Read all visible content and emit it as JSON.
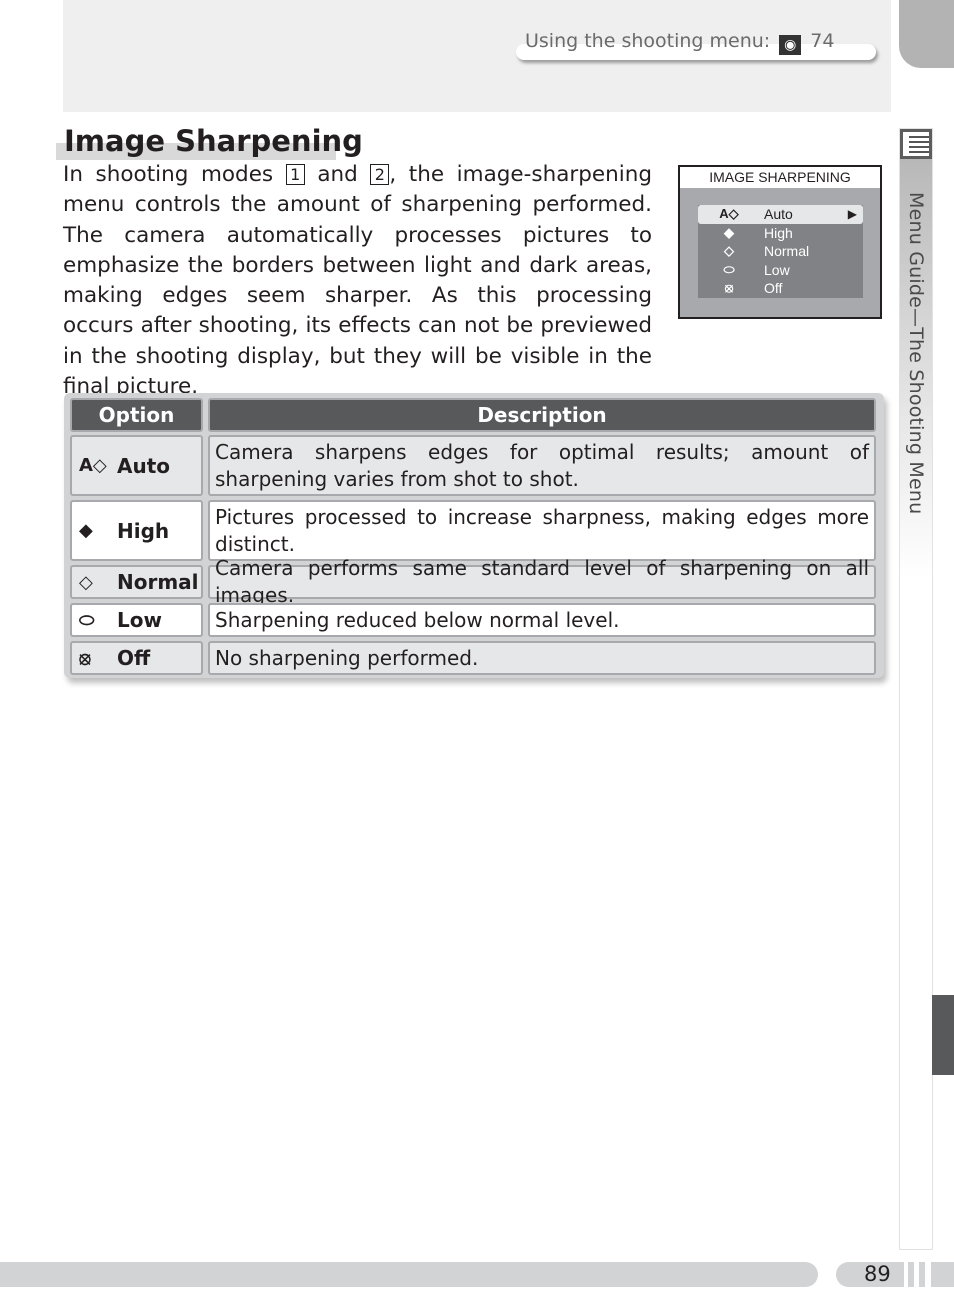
{
  "header": {
    "xref_text": "Using the shooting menu:",
    "xref_icon": "eye-icon",
    "xref_page": "74"
  },
  "side_tab": {
    "icon": "menu-list-icon",
    "label": "Menu Guide—The Shooting Menu"
  },
  "section": {
    "title": "Image Sharpening",
    "intro_part1": "In shooting modes ",
    "mode1": "1",
    "intro_and": " and ",
    "mode2": "2",
    "intro_part2": ", the image-sharpening menu controls the amount of sharpening performed. The camera automatically processes pictures to emphasize the borders between light and dark areas, making edges seem sharper.  As this processing occurs after shooting, its effects can not be previewed in the shooting display, but they will be visible in the final picture."
  },
  "camera_screen": {
    "title": "IMAGE SHARPENING",
    "items": [
      {
        "icon": "A◇",
        "icon_name": "auto-sharpening-icon",
        "label": "Auto",
        "selected": true,
        "arrow": "▶"
      },
      {
        "icon": "◆",
        "icon_name": "high-sharpening-icon",
        "label": "High",
        "selected": false
      },
      {
        "icon": "◇",
        "icon_name": "normal-sharpening-icon",
        "label": "Normal",
        "selected": false
      },
      {
        "icon": "⬭",
        "icon_name": "low-sharpening-icon",
        "label": "Low",
        "selected": false
      },
      {
        "icon": "⦻",
        "icon_name": "off-sharpening-icon",
        "label": "Off",
        "selected": false
      }
    ]
  },
  "table": {
    "headers": [
      "Option",
      "Description"
    ],
    "rows": [
      {
        "icon": "A◇",
        "icon_name": "auto-sharpening-icon",
        "option": "Auto",
        "description": "Camera sharpens edges for optimal results; amount of sharpening varies from shot to shot."
      },
      {
        "icon": "◆",
        "icon_name": "high-sharpening-icon",
        "option": "High",
        "description": "Pictures processed to increase sharpness, making edges more distinct."
      },
      {
        "icon": "◇",
        "icon_name": "normal-sharpening-icon",
        "option": "Normal",
        "description": "Camera performs same standard level of sharpening on all images."
      },
      {
        "icon": "⬭",
        "icon_name": "low-sharpening-icon",
        "option": "Low",
        "description": "Sharpening reduced below normal level."
      },
      {
        "icon": "⦻",
        "icon_name": "off-sharpening-icon",
        "option": "Off",
        "description": "No sharpening performed."
      }
    ]
  },
  "footer": {
    "page_number": "89"
  }
}
